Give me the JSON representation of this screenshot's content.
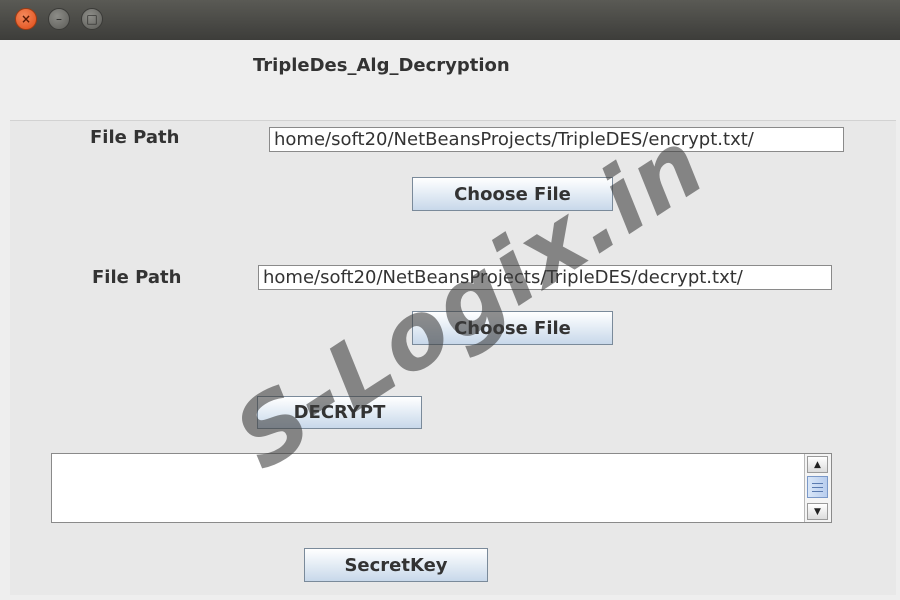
{
  "titlebar": {
    "close_glyph": "×",
    "minimize_glyph": "–",
    "maximize_glyph": "□"
  },
  "app": {
    "heading": "TripleDes_Alg_Decryption"
  },
  "form": {
    "encrypt_label": "File Path",
    "encrypt_path": "/home/soft20/NetBeansProjects/TripleDES/encrypt.txt",
    "choose_file_1": "Choose File",
    "decrypt_label": "File Path",
    "decrypt_path": "/home/soft20/NetBeansProjects/TripleDES/decrypt.txt",
    "choose_file_2": "Choose File",
    "decrypt_button": "DECRYPT",
    "output_text": "",
    "secret_key_button": "SecretKey"
  },
  "scrollbar": {
    "up_glyph": "▲",
    "down_glyph": "▼"
  },
  "watermark": {
    "text": "S-Logix.in"
  },
  "colors": {
    "titlebar": "#3d3d3a",
    "close_button": "#df4a16",
    "window_bg": "#eeeeee",
    "button_gradient_end": "#c8d8ea"
  }
}
